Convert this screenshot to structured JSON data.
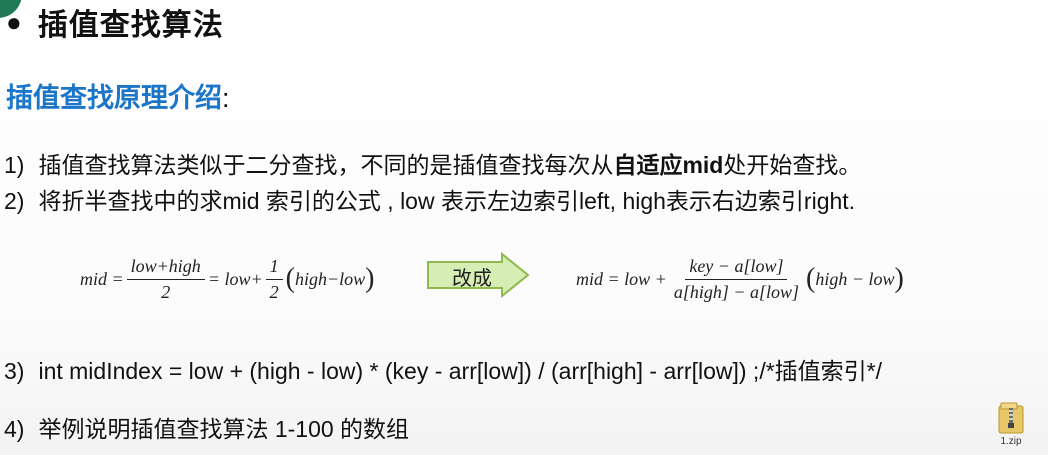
{
  "title": "插值查找算法",
  "bullet": "●",
  "subtitle": "插值查找原理介绍",
  "subtitle_colon": ":",
  "lines": [
    {
      "num": "1)",
      "text_a": "插值查找算法类似于二分查找，不同的是插值查找每次从",
      "text_bold": "自适应mid",
      "text_b": "处开始查找。"
    },
    {
      "num": "2)",
      "text": "将折半查找中的求mid 索引的公式 , low 表示左边索引left, high表示右边索引right."
    },
    {
      "num": "3)",
      "text": "int midIndex = low + (high - low) * (key - arr[low]) / (arr[high] - arr[low])  ;/*插值索引*/"
    },
    {
      "num": "4)",
      "text": "举例说明插值查找算法 1-100 的数组"
    }
  ],
  "formula_left": {
    "mid_eq": "mid =",
    "frac1_top": "low+high",
    "frac1_bot": "2",
    "eq_low_plus": "= low+",
    "frac2_top": "1",
    "frac2_bot": "2",
    "paren_expr": "high−low"
  },
  "arrow_label": "改成",
  "formula_right": {
    "mid_eq": "mid  = low +",
    "frac_top": "key − a[low]",
    "frac_bot": "a[high] − a[low]",
    "paren_expr": "high − low"
  },
  "zip_file": {
    "label": "1.zip",
    "icon": "zip-folder-icon"
  },
  "colors": {
    "accent": "#1b75c9",
    "arrow_fill": "#d6eeb4",
    "arrow_stroke": "#8fb84f"
  }
}
